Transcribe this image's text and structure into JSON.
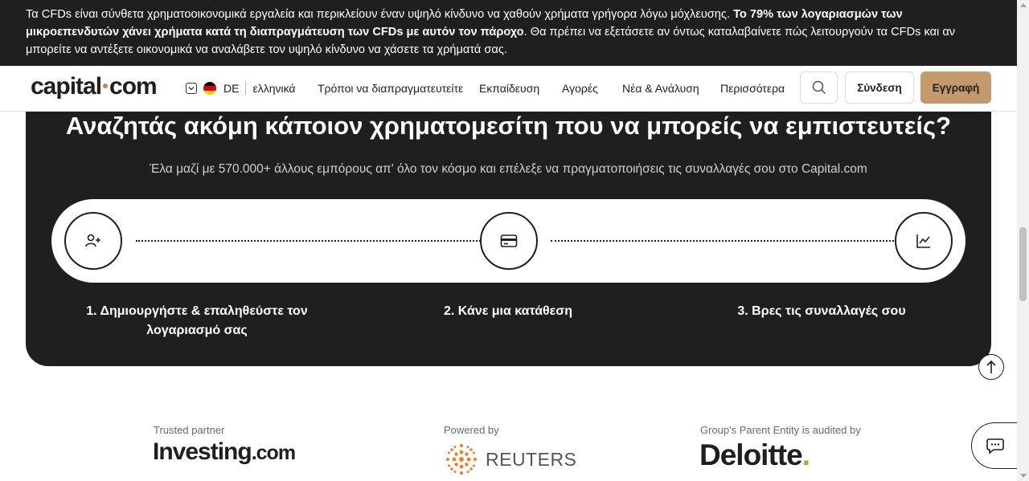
{
  "risk_banner": {
    "text_1": "Τα CFDs είναι σύνθετα χρηματοοικονομικά εργαλεία και περικλείουν έναν υψηλό κίνδυνο να χαθούν χρήματα γρήγορα λόγω μόχλευσης. ",
    "text_bold": "Το 79% των λογαριασμών των μικροεπενδυτών χάνει χρήματα κατά τη διαπραγμάτευση των CFDs με αυτόν τον πάροχο",
    "text_2": ". Θα πρέπει να εξετάσετε αν όντως καταλαβαίνετε πώς λειτουργούν τα CFDs και αν μπορείτε να αντέξετε οικονομικά να αναλάβετε τον υψηλό κίνδυνο να χάσετε τα χρήματά σας."
  },
  "header": {
    "logo_left": "capital",
    "logo_right": "com",
    "country": "DE",
    "language": "ελληνικά",
    "nav": [
      "Τρόποι να διαπραγματευτείτε",
      "Εκπαίδευση",
      "Αγορές",
      "Νέα & Ανάλυση",
      "Περισσότερα"
    ],
    "login_label": "Σύνδεση",
    "signup_label": "Εγγραφή",
    "brand_color": "#c49a6c"
  },
  "main": {
    "title": "Αναζητάς ακόμη κάποιον χρηματομεσίτη που να μπορείς να εμπιστευτείς?",
    "subtitle": "Έλα μαζί με 570.000+ άλλους εμπόρους απ' όλο τον κόσμο και επέλεξε να πραγματοποιήσεις τις συναλλαγές σου στο Capital.com",
    "steps": [
      {
        "icon": "user-plus-icon",
        "line1": "1. Δημιουργήστε & επαληθεύστε τον",
        "line2": "λογαριασμό σας"
      },
      {
        "icon": "credit-card-icon",
        "line1": "2. Κάνε μια κατάθεση",
        "line2": ""
      },
      {
        "icon": "chart-line-icon",
        "line1": "3. Βρες τις συναλλαγές σου",
        "line2": ""
      }
    ]
  },
  "partners": {
    "investing_caption": "Trusted partner",
    "investing_logo": "Investing",
    "investing_suffix": ".com",
    "reuters_caption": "Powered by",
    "reuters_logo": "REUTERS",
    "deloitte_caption": "Group's Parent Entity is audited by",
    "deloitte_logo": "Deloitte",
    "deloitte_dot": "."
  }
}
